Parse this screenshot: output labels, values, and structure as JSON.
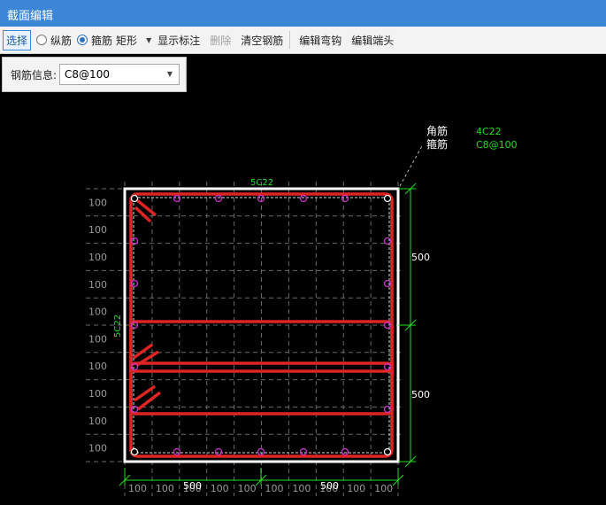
{
  "window": {
    "title": "截面编辑"
  },
  "toolbar": {
    "select": "选择",
    "longitudinal": "纵筋",
    "stirrup": "箍筋",
    "shape": "矩形",
    "show_labels": "显示标注",
    "delete": "删除",
    "clear_rebar": "清空钢筋",
    "edit_hook": "编辑弯钩",
    "edit_end": "编辑端头"
  },
  "info_panel": {
    "label": "钢筋信息:",
    "value": "C8@100"
  },
  "section": {
    "legend": {
      "corner_label": "角筋",
      "corner_value": "4C22",
      "stirrup_label": "箍筋",
      "stirrup_value": "C8@100"
    },
    "top_rebar": "5C22",
    "side_rebar": "5C22",
    "dim_right": [
      "500",
      "500"
    ],
    "dim_bottom": [
      "500",
      "500"
    ],
    "grid_label": "100"
  },
  "colors": {
    "titlebar": "#3b86d6",
    "section_outline": "#ffffff",
    "stirrup": "#e02424",
    "rebar": "#cc33cc",
    "annotation": "#22dd22",
    "grid": "#6a6a6a"
  }
}
